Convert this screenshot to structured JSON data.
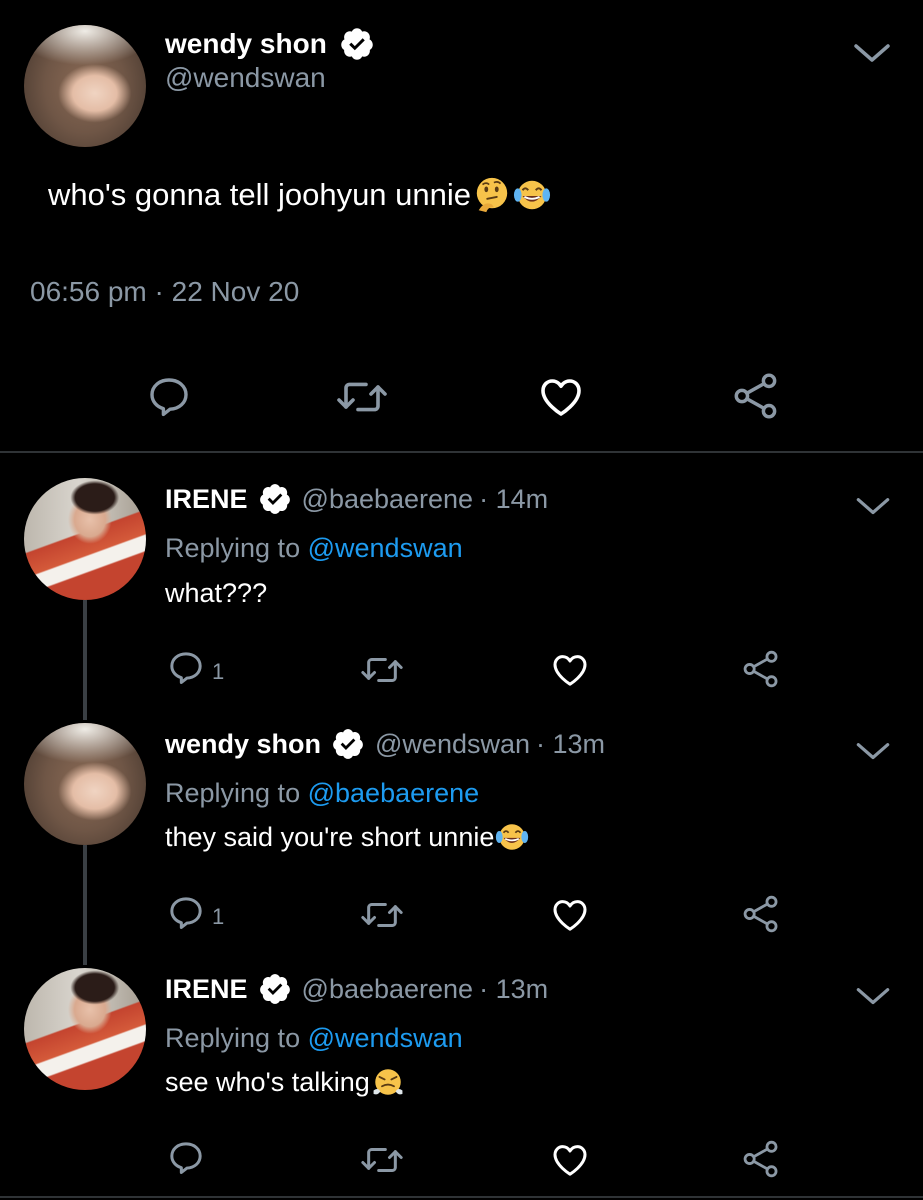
{
  "main_tweet": {
    "name": "wendy shon",
    "handle": "@wendswan",
    "text": "who's gonna tell joohyun unnie",
    "emojis": [
      "thinking-face",
      "face-with-tears-of-joy"
    ],
    "timestamp": "06:56 pm · 22 Nov 20"
  },
  "replies": [
    {
      "name": "IRENE",
      "handle": "@baebaerene",
      "time": "· 14m",
      "replying_prefix": "Replying to",
      "replying_to": "@wendswan",
      "text": "what???",
      "reply_count": "1"
    },
    {
      "name": "wendy shon",
      "handle": "@wendswan",
      "time": "· 13m",
      "replying_prefix": "Replying to",
      "replying_to": "@baebaerene",
      "text": "they said you're short unnie",
      "reply_count": "1"
    },
    {
      "name": "IRENE",
      "handle": "@baebaerene",
      "time": "· 13m",
      "replying_prefix": "Replying to",
      "replying_to": "@wendswan",
      "text": "see who's talking",
      "reply_count": ""
    }
  ],
  "colors": {
    "background": "#000000",
    "muted": "#8b98a5",
    "link": "#1d9bf0",
    "divider": "#2f3336"
  }
}
